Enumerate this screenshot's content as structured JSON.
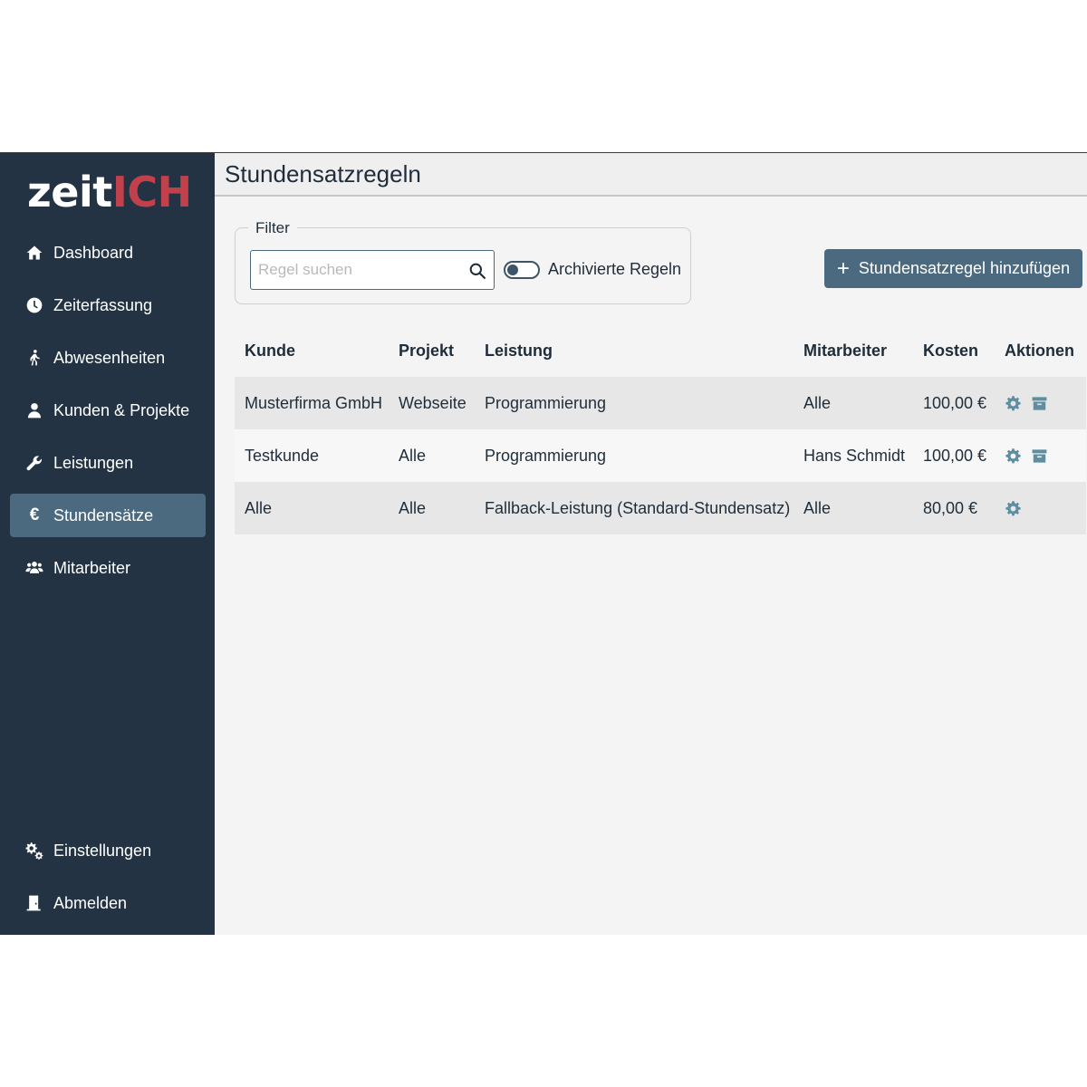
{
  "app": {
    "logo_part1": "zeit",
    "logo_part2": "ICH"
  },
  "sidebar": {
    "items": [
      {
        "label": "Dashboard",
        "icon": "home-icon"
      },
      {
        "label": "Zeiterfassung",
        "icon": "clock-icon"
      },
      {
        "label": "Abwesenheiten",
        "icon": "walking-icon"
      },
      {
        "label": "Kunden & Projekte",
        "icon": "user-icon"
      },
      {
        "label": "Leistungen",
        "icon": "wrench-icon"
      },
      {
        "label": "Stundensätze",
        "icon": "euro-icon",
        "symbol": "€",
        "active": true
      },
      {
        "label": "Mitarbeiter",
        "icon": "users-icon"
      }
    ],
    "bottom_items": [
      {
        "label": "Einstellungen",
        "icon": "cogs-icon"
      },
      {
        "label": "Abmelden",
        "icon": "door-icon"
      }
    ]
  },
  "main": {
    "title": "Stundensatzregeln",
    "filter": {
      "legend": "Filter",
      "search_placeholder": "Regel suchen",
      "search_value": "",
      "toggle_label": "Archivierte Regeln",
      "toggle_on": false
    },
    "add_button_label": "Stundensatzregel hinzufügen",
    "add_button_symbol": "+",
    "table": {
      "headers": [
        "Kunde",
        "Projekt",
        "Leistung",
        "Mitarbeiter",
        "Kosten",
        "Aktionen"
      ],
      "rows": [
        {
          "kunde": "Musterfirma GmbH",
          "projekt": "Webseite",
          "leistung": "Programmierung",
          "mitarbeiter": "Alle",
          "kosten": "100,00 €",
          "actions": [
            "settings",
            "archive"
          ]
        },
        {
          "kunde": "Testkunde",
          "projekt": "Alle",
          "leistung": "Programmierung",
          "mitarbeiter": "Hans Schmidt",
          "kosten": "100,00 €",
          "actions": [
            "settings",
            "archive"
          ]
        },
        {
          "kunde": "Alle",
          "projekt": "Alle",
          "leistung": "Fallback-Leistung (Standard-Stundensatz)",
          "mitarbeiter": "Alle",
          "kosten": "80,00 €",
          "actions": [
            "settings"
          ]
        }
      ]
    }
  },
  "colors": {
    "sidebar_bg": "#233343",
    "accent": "#4b6a7f",
    "logo_red": "#c0404c",
    "action_icon": "#5e8ea1"
  }
}
